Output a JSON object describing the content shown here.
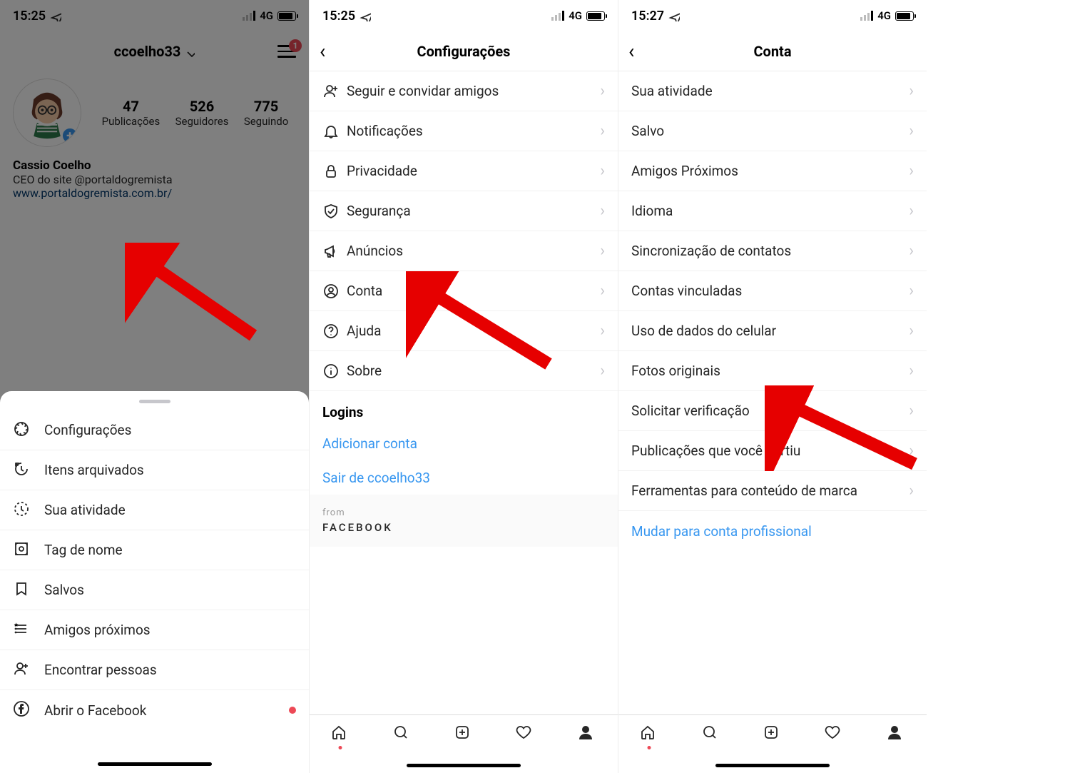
{
  "screen1": {
    "status": {
      "time": "15:25",
      "network": "4G"
    },
    "profile": {
      "username": "ccoelho33",
      "badge": "1",
      "stats": {
        "posts": {
          "value": "47",
          "label": "Publicações"
        },
        "followers": {
          "value": "526",
          "label": "Seguidores"
        },
        "following": {
          "value": "775",
          "label": "Seguindo"
        }
      },
      "name": "Cassio Coelho",
      "bio": "CEO do site @portaldogremista",
      "website": "www.portaldogremista.com.br/"
    },
    "menu": [
      {
        "label": "Configurações",
        "icon": "settings"
      },
      {
        "label": "Itens arquivados",
        "icon": "archive"
      },
      {
        "label": "Sua atividade",
        "icon": "activity"
      },
      {
        "label": "Tag de nome",
        "icon": "nametag"
      },
      {
        "label": "Salvos",
        "icon": "bookmark"
      },
      {
        "label": "Amigos próximos",
        "icon": "close-friends"
      },
      {
        "label": "Encontrar pessoas",
        "icon": "add-person"
      },
      {
        "label": "Abrir o Facebook",
        "icon": "facebook"
      }
    ]
  },
  "screen2": {
    "status": {
      "time": "15:25",
      "network": "4G"
    },
    "title": "Configurações",
    "items": [
      {
        "label": "Seguir e convidar amigos",
        "icon": "add-person"
      },
      {
        "label": "Notificações",
        "icon": "bell"
      },
      {
        "label": "Privacidade",
        "icon": "lock"
      },
      {
        "label": "Segurança",
        "icon": "shield"
      },
      {
        "label": "Anúncios",
        "icon": "megaphone"
      },
      {
        "label": "Conta",
        "icon": "account"
      },
      {
        "label": "Ajuda",
        "icon": "help"
      },
      {
        "label": "Sobre",
        "icon": "info"
      }
    ],
    "logins_header": "Logins",
    "add_account": "Adicionar conta",
    "logout": "Sair de ccoelho33",
    "from": "from",
    "facebook": "FACEBOOK"
  },
  "screen3": {
    "status": {
      "time": "15:27",
      "network": "4G"
    },
    "title": "Conta",
    "items": [
      {
        "label": "Sua atividade"
      },
      {
        "label": "Salvo"
      },
      {
        "label": "Amigos Próximos"
      },
      {
        "label": "Idioma"
      },
      {
        "label": "Sincronização de contatos"
      },
      {
        "label": "Contas vinculadas"
      },
      {
        "label": "Uso de dados do celular"
      },
      {
        "label": "Fotos originais"
      },
      {
        "label": "Solicitar verificação"
      },
      {
        "label": "Publicações que você curtiu"
      },
      {
        "label": "Ferramentas para conteúdo de marca"
      }
    ],
    "switch_account": "Mudar para conta profissional"
  }
}
